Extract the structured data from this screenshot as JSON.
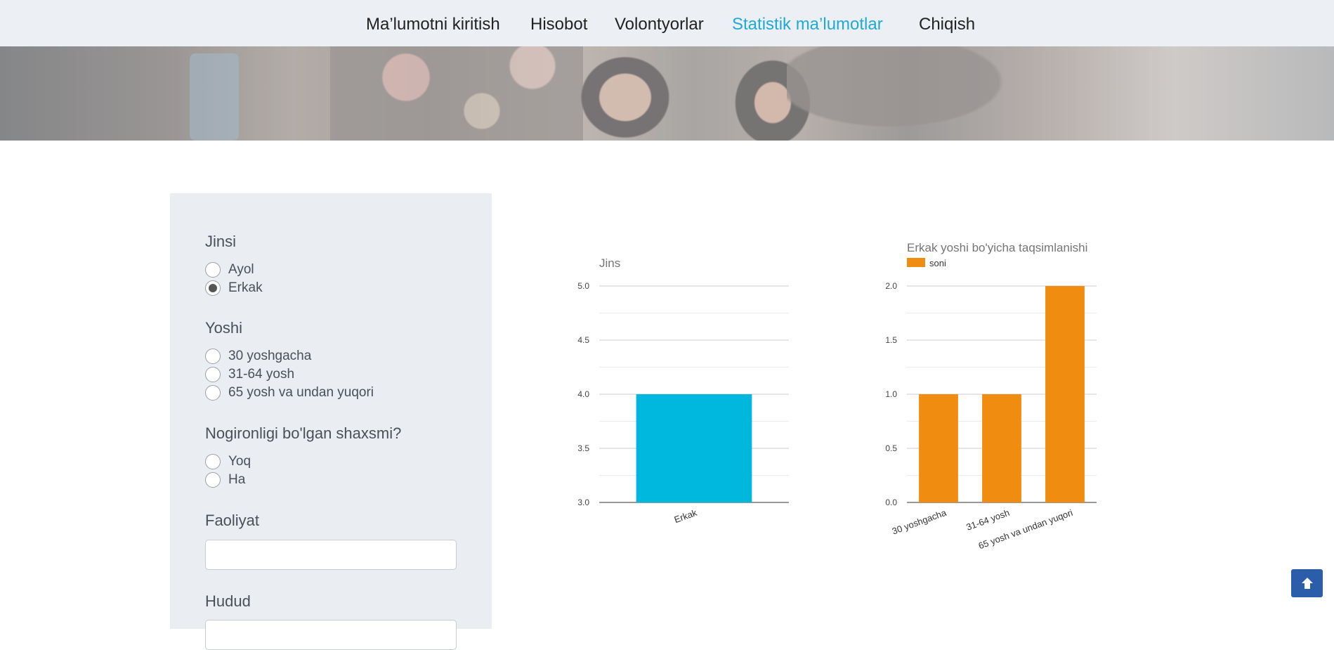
{
  "nav": {
    "items": [
      "Ma’lumotni kiritish",
      "Hisobot",
      "Volontyorlar",
      "Statistik ma’lumotlar",
      "Chiqish"
    ],
    "active_index": 3,
    "active_color": "#1fa9d8"
  },
  "filters": {
    "gender": {
      "title": "Jinsi",
      "options": [
        "Ayol",
        "Erkak"
      ],
      "selected": "Erkak"
    },
    "age": {
      "title": "Yoshi",
      "options": [
        "30 yoshgacha",
        "31-64 yosh",
        "65 yosh va undan yuqori"
      ]
    },
    "disability": {
      "title": "Nogironligi bo'lgan shaxsmi?",
      "options": [
        "Yoq",
        "Ha"
      ]
    },
    "activity": {
      "title": "Faoliyat",
      "value": ""
    },
    "region": {
      "title": "Hudud"
    }
  },
  "chart_data": [
    {
      "type": "bar",
      "title": "Jins",
      "categories": [
        "Erkak"
      ],
      "values": [
        4
      ],
      "ylim": [
        3,
        5
      ],
      "yticks": [
        "3.0",
        "3.5",
        "4.0",
        "4.5",
        "5.0"
      ],
      "color": "#00b8de",
      "grid": true
    },
    {
      "type": "bar",
      "title": "Erkak yoshi bo'yicha taqsimlanishi",
      "legend": "soni",
      "categories": [
        "30 yoshgacha",
        "31-64 yosh",
        "65 yosh va undan yuqori"
      ],
      "values": [
        1,
        1,
        2
      ],
      "ylim": [
        0,
        2
      ],
      "yticks": [
        "0.0",
        "0.5",
        "1.0",
        "1.5",
        "2.0"
      ],
      "color": "#f08c0f",
      "grid": true
    }
  ],
  "scroll_top": {
    "icon": "arrow-up-icon",
    "color": "#2a5eab"
  }
}
